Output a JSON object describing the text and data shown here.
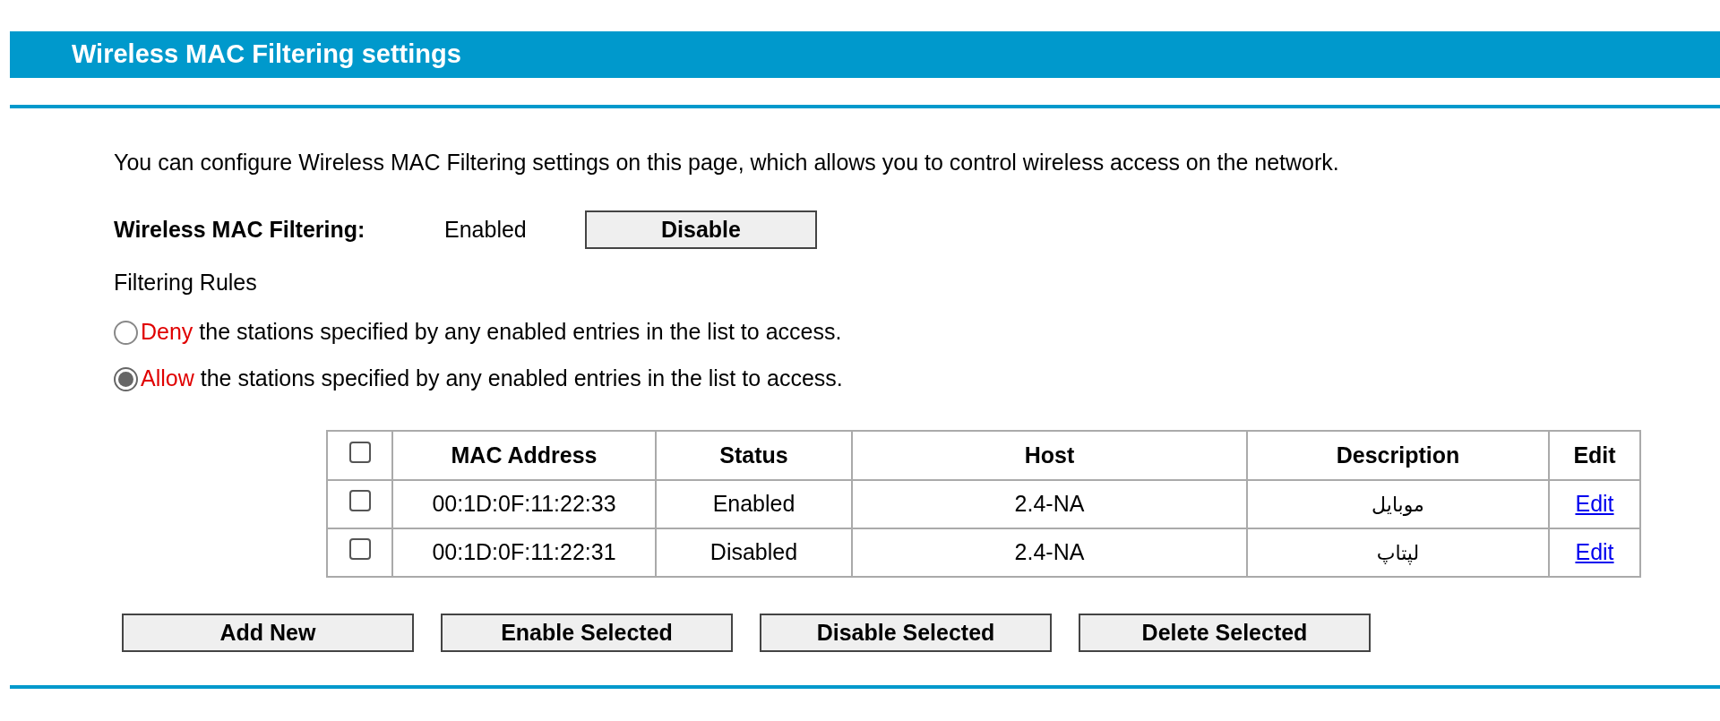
{
  "header": {
    "title": "Wireless MAC Filtering settings"
  },
  "intro": "You can configure Wireless MAC Filtering settings on this page, which allows you to control wireless access on the network.",
  "filtering": {
    "label": "Wireless MAC Filtering:",
    "value": "Enabled",
    "button": "Disable"
  },
  "rules": {
    "title": "Filtering Rules",
    "options": [
      {
        "keyword": "Deny",
        "text": "the stations specified by any enabled entries in the list to access.",
        "selected": false
      },
      {
        "keyword": "Allow",
        "text": "the stations specified by any enabled entries in the list to access.",
        "selected": true
      }
    ]
  },
  "table": {
    "select_all_checked": false,
    "columns": [
      "MAC Address",
      "Status",
      "Host",
      "Description",
      "Edit"
    ],
    "rows": [
      {
        "checked": false,
        "mac": "00:1D:0F:11:22:33",
        "status": "Enabled",
        "host": "2.4-NA",
        "description": "موبایل",
        "edit": "Edit"
      },
      {
        "checked": false,
        "mac": "00:1D:0F:11:22:31",
        "status": "Disabled",
        "host": "2.4-NA",
        "description": "لپتاپ",
        "edit": "Edit"
      }
    ]
  },
  "buttons": [
    "Add New",
    "Enable Selected",
    "Disable Selected",
    "Delete Selected"
  ]
}
